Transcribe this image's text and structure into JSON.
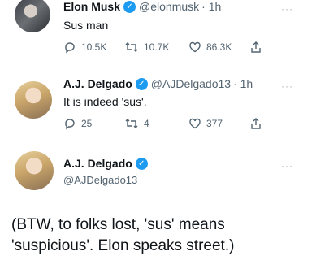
{
  "tweet1": {
    "name": "Elon Musk",
    "handle": "@elonmusk",
    "time": "· 1h",
    "text": "Sus man",
    "replies": "10.5K",
    "retweets": "10.7K",
    "likes": "86.3K"
  },
  "tweet2": {
    "name": "A.J. Delgado",
    "handle": "@AJDelgado13",
    "time": "· 1h",
    "text": "It is indeed 'sus'.",
    "replies": "25",
    "retweets": "4",
    "likes": "377"
  },
  "tweet3": {
    "name": "A.J. Delgado",
    "handle": "@AJDelgado13",
    "text": "(BTW, to folks lost, 'sus' means 'suspicious'. Elon speaks street.)"
  },
  "icons": {
    "reply": "reply-icon",
    "retweet": "retweet-icon",
    "like": "heart-icon",
    "share": "share-icon",
    "verified": "verified-badge-icon"
  },
  "colors": {
    "verified": "#1d9bf0",
    "secondary_text": "#536471"
  }
}
